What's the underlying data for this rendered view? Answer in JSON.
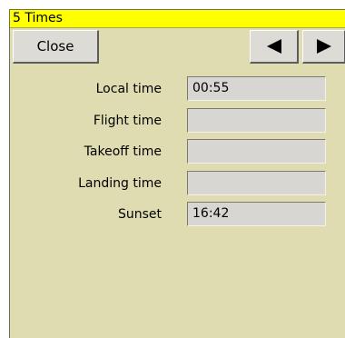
{
  "window": {
    "title": "5 Times"
  },
  "toolbar": {
    "close_label": "Close",
    "prev_icon": "left-triangle-icon",
    "next_icon": "right-triangle-icon"
  },
  "fields": [
    {
      "label": "Local time",
      "value": "00:55"
    },
    {
      "label": "Flight time",
      "value": ""
    },
    {
      "label": "Takeoff time",
      "value": ""
    },
    {
      "label": "Landing time",
      "value": ""
    },
    {
      "label": "Sunset",
      "value": "16:42"
    }
  ],
  "colors": {
    "title_bar": "#ffff00",
    "background": "#dedcb0",
    "field_bg": "#d8d6d3"
  }
}
